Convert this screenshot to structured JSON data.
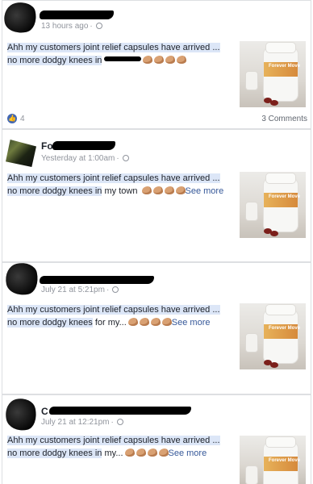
{
  "posts": [
    {
      "time": "13 hours ago",
      "text_line1": "Ahh my customers joint relief capsules have arrived ...",
      "text_line2": "no more dodgy knees in",
      "likes": "4",
      "comments": "3 Comments"
    },
    {
      "name_visible": "Fo",
      "time": "Yesterday at 1:00am",
      "text_line1": "Ahh my customers joint relief capsules have arrived ...",
      "text_line2_a": "no more dodgy knees in",
      "text_line2_b": "my town",
      "see_more": "See more"
    },
    {
      "time": "July 21 at 5:21pm",
      "text_line1": "Ahh my customers joint relief capsules have arrived ...",
      "text_line2_a": "no more dodgy knees",
      "text_line2_b": "for my...",
      "see_more": "See more"
    },
    {
      "name_visible": "C",
      "time": "July 21 at 12:21pm",
      "text_line1": "Ahh my customers joint relief capsules have arrived ...",
      "text_line2_a": "no more dodgy knees in",
      "text_line2_b": "my...",
      "see_more": "See more"
    }
  ],
  "product_label": "Forever Move",
  "icons": {
    "privacy": "globe-icon",
    "reaction": "like-icon",
    "emoji": "flexed-biceps-emoji"
  },
  "colors": {
    "link": "#365899",
    "meta": "#90949c",
    "highlight": "#dce6f7",
    "like_blue": "#4267b2"
  }
}
